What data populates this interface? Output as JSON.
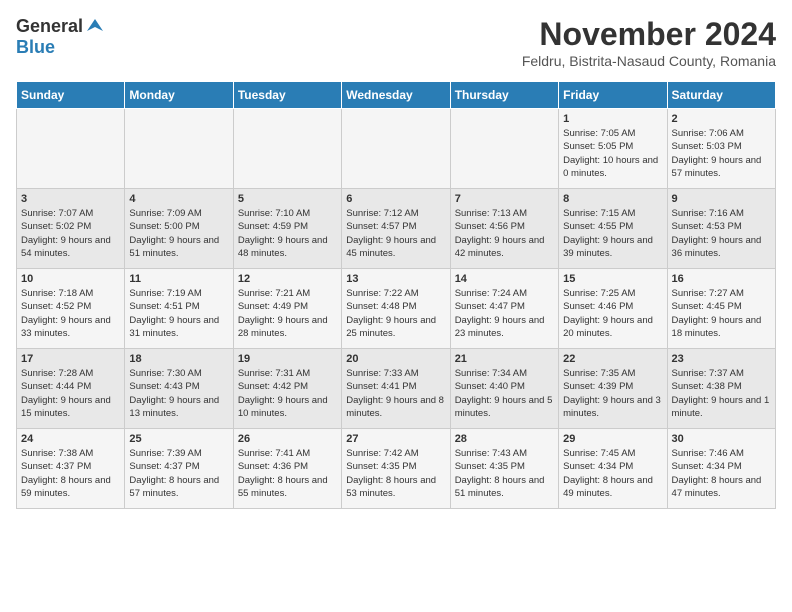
{
  "logo": {
    "general": "General",
    "blue": "Blue"
  },
  "title": "November 2024",
  "location": "Feldru, Bistrita-Nasaud County, Romania",
  "days_of_week": [
    "Sunday",
    "Monday",
    "Tuesday",
    "Wednesday",
    "Thursday",
    "Friday",
    "Saturday"
  ],
  "weeks": [
    [
      {
        "day": "",
        "info": ""
      },
      {
        "day": "",
        "info": ""
      },
      {
        "day": "",
        "info": ""
      },
      {
        "day": "",
        "info": ""
      },
      {
        "day": "",
        "info": ""
      },
      {
        "day": "1",
        "info": "Sunrise: 7:05 AM\nSunset: 5:05 PM\nDaylight: 10 hours and 0 minutes."
      },
      {
        "day": "2",
        "info": "Sunrise: 7:06 AM\nSunset: 5:03 PM\nDaylight: 9 hours and 57 minutes."
      }
    ],
    [
      {
        "day": "3",
        "info": "Sunrise: 7:07 AM\nSunset: 5:02 PM\nDaylight: 9 hours and 54 minutes."
      },
      {
        "day": "4",
        "info": "Sunrise: 7:09 AM\nSunset: 5:00 PM\nDaylight: 9 hours and 51 minutes."
      },
      {
        "day": "5",
        "info": "Sunrise: 7:10 AM\nSunset: 4:59 PM\nDaylight: 9 hours and 48 minutes."
      },
      {
        "day": "6",
        "info": "Sunrise: 7:12 AM\nSunset: 4:57 PM\nDaylight: 9 hours and 45 minutes."
      },
      {
        "day": "7",
        "info": "Sunrise: 7:13 AM\nSunset: 4:56 PM\nDaylight: 9 hours and 42 minutes."
      },
      {
        "day": "8",
        "info": "Sunrise: 7:15 AM\nSunset: 4:55 PM\nDaylight: 9 hours and 39 minutes."
      },
      {
        "day": "9",
        "info": "Sunrise: 7:16 AM\nSunset: 4:53 PM\nDaylight: 9 hours and 36 minutes."
      }
    ],
    [
      {
        "day": "10",
        "info": "Sunrise: 7:18 AM\nSunset: 4:52 PM\nDaylight: 9 hours and 33 minutes."
      },
      {
        "day": "11",
        "info": "Sunrise: 7:19 AM\nSunset: 4:51 PM\nDaylight: 9 hours and 31 minutes."
      },
      {
        "day": "12",
        "info": "Sunrise: 7:21 AM\nSunset: 4:49 PM\nDaylight: 9 hours and 28 minutes."
      },
      {
        "day": "13",
        "info": "Sunrise: 7:22 AM\nSunset: 4:48 PM\nDaylight: 9 hours and 25 minutes."
      },
      {
        "day": "14",
        "info": "Sunrise: 7:24 AM\nSunset: 4:47 PM\nDaylight: 9 hours and 23 minutes."
      },
      {
        "day": "15",
        "info": "Sunrise: 7:25 AM\nSunset: 4:46 PM\nDaylight: 9 hours and 20 minutes."
      },
      {
        "day": "16",
        "info": "Sunrise: 7:27 AM\nSunset: 4:45 PM\nDaylight: 9 hours and 18 minutes."
      }
    ],
    [
      {
        "day": "17",
        "info": "Sunrise: 7:28 AM\nSunset: 4:44 PM\nDaylight: 9 hours and 15 minutes."
      },
      {
        "day": "18",
        "info": "Sunrise: 7:30 AM\nSunset: 4:43 PM\nDaylight: 9 hours and 13 minutes."
      },
      {
        "day": "19",
        "info": "Sunrise: 7:31 AM\nSunset: 4:42 PM\nDaylight: 9 hours and 10 minutes."
      },
      {
        "day": "20",
        "info": "Sunrise: 7:33 AM\nSunset: 4:41 PM\nDaylight: 9 hours and 8 minutes."
      },
      {
        "day": "21",
        "info": "Sunrise: 7:34 AM\nSunset: 4:40 PM\nDaylight: 9 hours and 5 minutes."
      },
      {
        "day": "22",
        "info": "Sunrise: 7:35 AM\nSunset: 4:39 PM\nDaylight: 9 hours and 3 minutes."
      },
      {
        "day": "23",
        "info": "Sunrise: 7:37 AM\nSunset: 4:38 PM\nDaylight: 9 hours and 1 minute."
      }
    ],
    [
      {
        "day": "24",
        "info": "Sunrise: 7:38 AM\nSunset: 4:37 PM\nDaylight: 8 hours and 59 minutes."
      },
      {
        "day": "25",
        "info": "Sunrise: 7:39 AM\nSunset: 4:37 PM\nDaylight: 8 hours and 57 minutes."
      },
      {
        "day": "26",
        "info": "Sunrise: 7:41 AM\nSunset: 4:36 PM\nDaylight: 8 hours and 55 minutes."
      },
      {
        "day": "27",
        "info": "Sunrise: 7:42 AM\nSunset: 4:35 PM\nDaylight: 8 hours and 53 minutes."
      },
      {
        "day": "28",
        "info": "Sunrise: 7:43 AM\nSunset: 4:35 PM\nDaylight: 8 hours and 51 minutes."
      },
      {
        "day": "29",
        "info": "Sunrise: 7:45 AM\nSunset: 4:34 PM\nDaylight: 8 hours and 49 minutes."
      },
      {
        "day": "30",
        "info": "Sunrise: 7:46 AM\nSunset: 4:34 PM\nDaylight: 8 hours and 47 minutes."
      }
    ]
  ]
}
